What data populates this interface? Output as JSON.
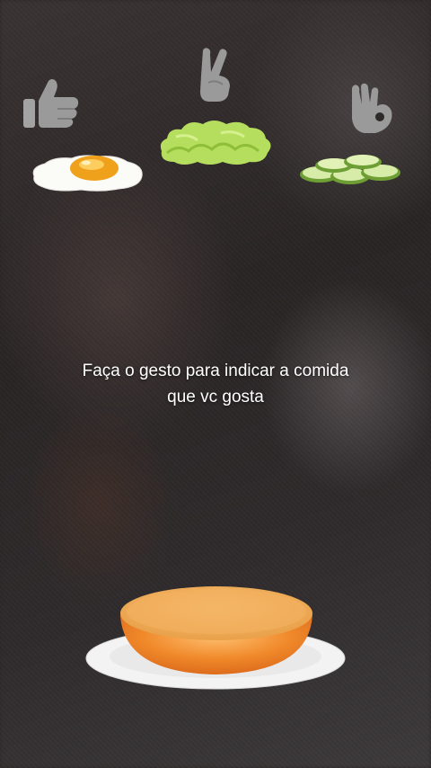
{
  "gestures": [
    {
      "icon": "thumbs-up-icon"
    },
    {
      "icon": "peace-sign-icon"
    },
    {
      "icon": "ok-hand-icon"
    }
  ],
  "foods": [
    {
      "icon": "fried-egg-icon"
    },
    {
      "icon": "lettuce-icon"
    },
    {
      "icon": "cucumber-slices-icon"
    }
  ],
  "prompt": {
    "line1": "Faça o gesto para indicar a comida",
    "line2": "que vc gosta"
  },
  "bowl": {
    "icon": "orange-bowl-icon"
  },
  "colors": {
    "gesture_gray": "#9a9a9a",
    "egg_yolk": "#f2a21a",
    "lettuce_green": "#a8d64a",
    "cucumber_green": "#7cae3c",
    "bowl_orange": "#f08a24",
    "plate_white": "#f4f4f4"
  }
}
